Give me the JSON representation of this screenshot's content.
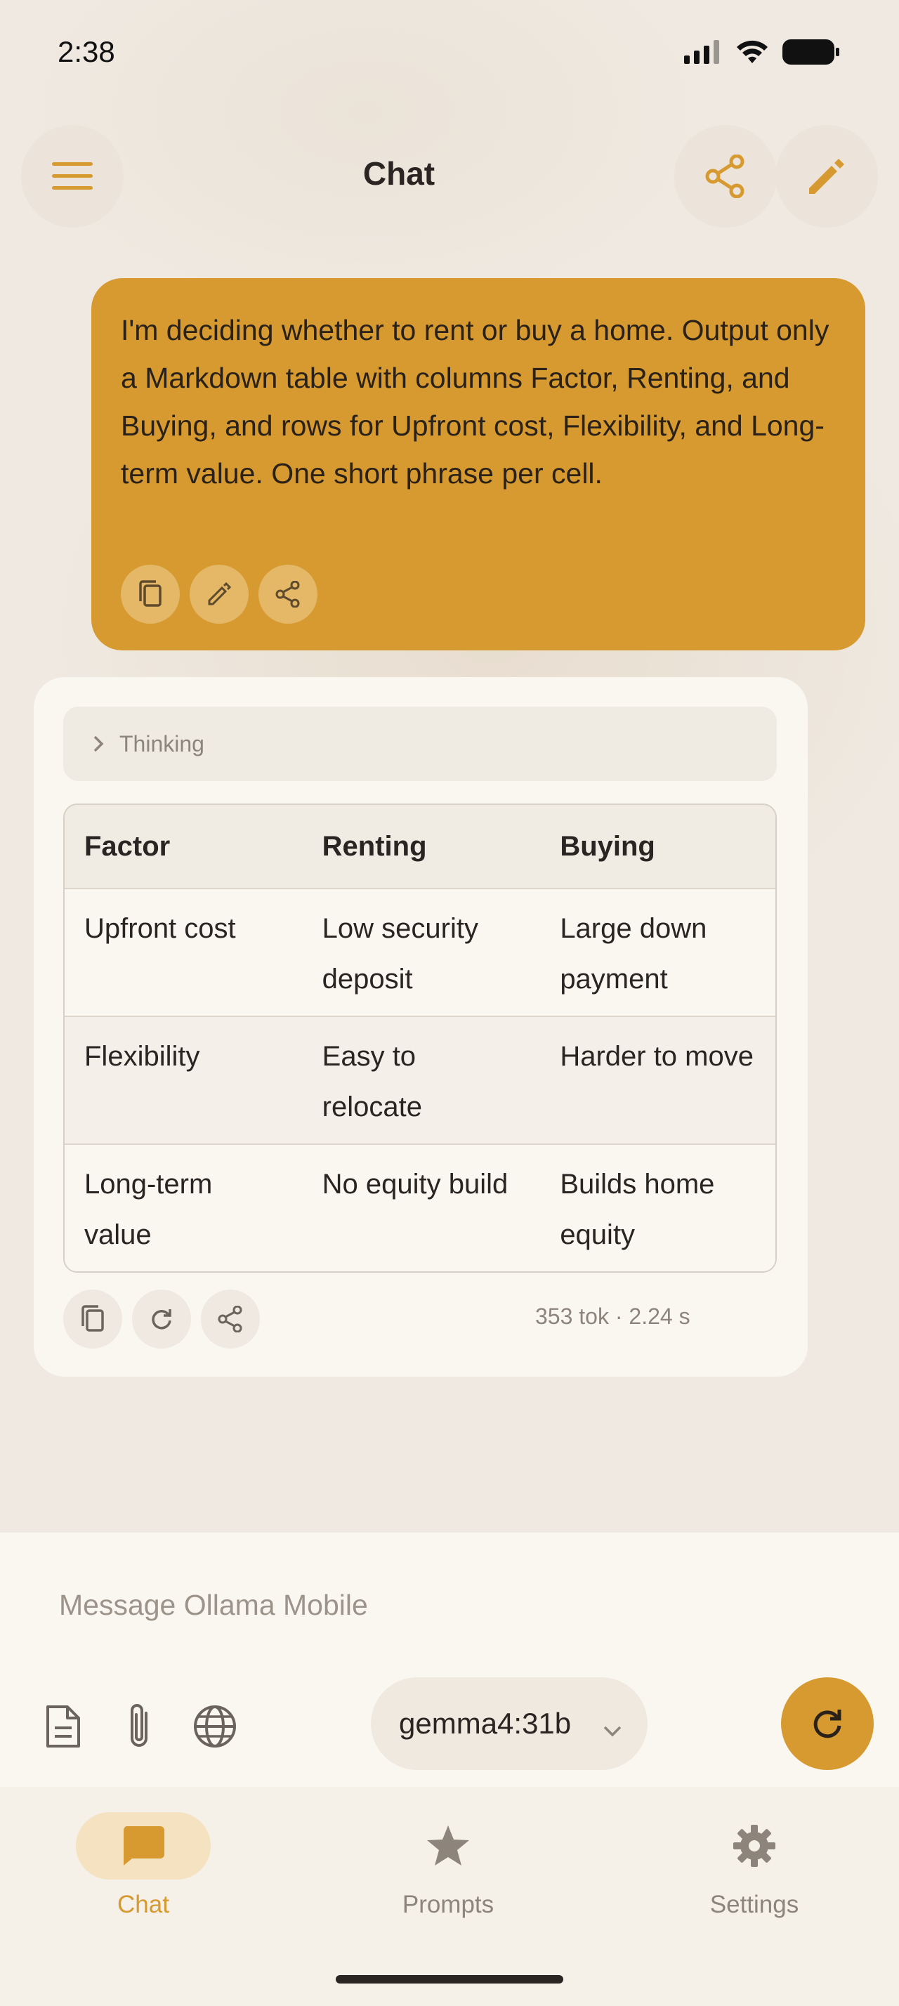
{
  "status_bar": {
    "time": "2:38"
  },
  "header": {
    "title": "Chat"
  },
  "user_message": {
    "text": "I'm deciding whether to rent or buy a home. Output only a Markdown table with columns Factor, Renting, and Buying, and rows for Upfront cost, Flexibility, and Long-term value. One short phrase per cell."
  },
  "assistant": {
    "thinking_label": "Thinking",
    "table": {
      "headers": [
        "Factor",
        "Renting",
        "Buying"
      ],
      "rows": [
        [
          "Upfront cost",
          "Low security deposit",
          "Large down payment"
        ],
        [
          "Flexibility",
          "Easy to relocate",
          "Harder to move"
        ],
        [
          "Long-term value",
          "No equity build",
          "Builds home equity"
        ]
      ]
    },
    "stats": "353 tok · 2.24 s"
  },
  "composer": {
    "placeholder": "Message Ollama Mobile",
    "model": "gemma4:31b"
  },
  "nav": {
    "items": [
      {
        "label": "Chat",
        "active": true
      },
      {
        "label": "Prompts",
        "active": false
      },
      {
        "label": "Settings",
        "active": false
      }
    ]
  },
  "colors": {
    "accent": "#d69a31",
    "background": "#efe9e1",
    "card": "#faf7f1"
  }
}
